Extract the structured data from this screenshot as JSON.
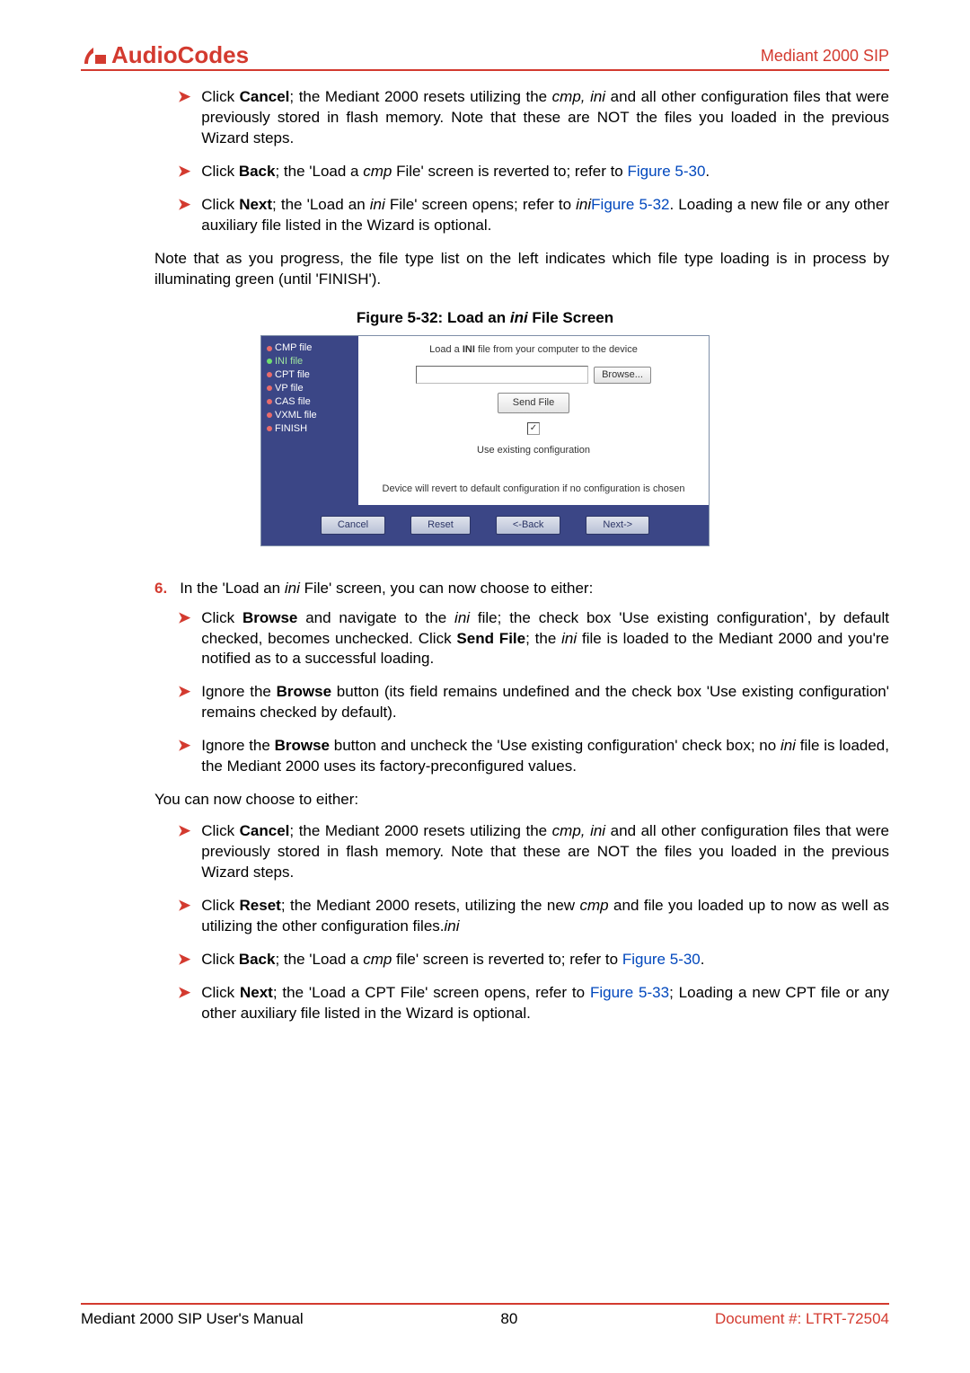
{
  "header": {
    "logo_text": "AudioCodes",
    "right": "Mediant 2000 SIP"
  },
  "bullets_a": [
    {
      "pre": "Click ",
      "b": "Cancel",
      "post_a": "; the Mediant 2000 resets utilizing the ",
      "i": "cmp, ini",
      "post_b": " and all other configuration files that were previously stored in flash memory. Note that these are NOT the files you loaded in the previous Wizard steps."
    },
    {
      "pre": "Click ",
      "b": "Back",
      "post_a": "; the 'Load a ",
      "i": "cmp",
      "post_b": " File' screen is reverted to; refer to ",
      "xref": "Figure 5-30",
      "tail": "."
    },
    {
      "pre": "Click ",
      "b": "Next",
      "post_a": "; the 'Load an ",
      "i": "ini",
      "post_b": " File' screen opens; refer to ",
      "xref": "Figure 5-32",
      "tail": ". Loading a new ",
      "i2": "ini",
      "tail2": " file or any other auxiliary file listed in the Wizard is optional."
    }
  ],
  "note": "Note that as you progress, the file type list on the left indicates which file type loading is in process by illuminating green (until 'FINISH').",
  "fig_caption": {
    "pre": "Figure 5-32: Load an ",
    "i": "ini",
    "post": " File Screen"
  },
  "figure": {
    "sidebar": [
      "CMP file",
      "INI file",
      "CPT file",
      "VP file",
      "CAS file",
      "VXML file",
      "FINISH"
    ],
    "instruction_pre": "Load a ",
    "instruction_b": "INI",
    "instruction_post": " file from your computer to the device",
    "browse": "Browse...",
    "send": "Send File",
    "use_existing": "Use existing configuration",
    "revert": "Device will revert to default configuration if no configuration is chosen",
    "buttons": [
      "Cancel",
      "Reset",
      "<-Back",
      "Next->"
    ]
  },
  "step6": {
    "num": "6.",
    "pre": "In the 'Load an ",
    "i": "ini",
    "post": " File' screen, you can now choose to either:"
  },
  "bullets_b": [
    {
      "pre": "Click ",
      "b": "Browse",
      "post_a": " and navigate to the ",
      "i": "ini",
      "post_b": " file; the check box 'Use existing configuration', by default checked, becomes unchecked. Click ",
      "b2": "Send File",
      "post_c": "; the ",
      "i2": "ini",
      "post_d": " file is loaded to the Mediant 2000 and you're notified as to a successful loading."
    },
    {
      "pre": "Ignore the ",
      "b": "Browse",
      "post_a": " button (its field remains undefined and the check box 'Use existing configuration' remains checked by default)."
    },
    {
      "pre": "Ignore the ",
      "b": "Browse",
      "post_a": " button and uncheck the 'Use existing configuration' check box; no ",
      "i": "ini",
      "post_b": " file is loaded, the Mediant 2000 uses its factory-preconfigured values."
    }
  ],
  "you_can": "You can now choose to either:",
  "bullets_c": [
    {
      "pre": "Click ",
      "b": "Cancel",
      "post_a": "; the Mediant 2000 resets utilizing the ",
      "i": "cmp, ini",
      "post_b": " and all other configuration files that were previously stored in flash memory. Note that these are NOT the files you loaded in the previous Wizard steps."
    },
    {
      "pre": "Click ",
      "b": "Reset",
      "post_a": "; the Mediant 2000 resets, utilizing the new ",
      "i": "cmp",
      "post_b": " and ",
      "i2": "ini",
      "post_c": " file you loaded up to now as well as utilizing the other configuration files."
    },
    {
      "pre": "Click ",
      "b": "Back",
      "post_a": "; the 'Load a ",
      "i": "cmp",
      "post_b": " file' screen is reverted to; refer to ",
      "xref": "Figure 5-30",
      "tail": "."
    },
    {
      "pre": "Click ",
      "b": "Next",
      "post_a": "; the 'Load a CPT File' screen opens, refer to ",
      "xref": "Figure 5-33",
      "tail": "; Loading a new CPT file or any other auxiliary file listed in the Wizard is optional."
    }
  ],
  "footer": {
    "left": "Mediant 2000 SIP User's Manual",
    "center": "80",
    "right": "Document #: LTRT-72504"
  }
}
